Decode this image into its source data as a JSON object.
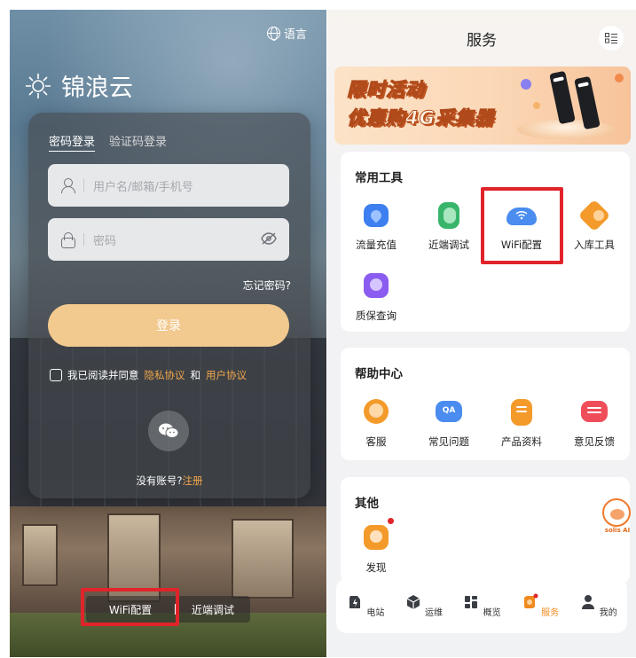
{
  "left": {
    "language_label": "语言",
    "brand_name": "锦浪云",
    "tabs": [
      "密码登录",
      "验证码登录"
    ],
    "username_placeholder": "用户名/邮箱/手机号",
    "password_placeholder": "密码",
    "forgot_label": "忘记密码?",
    "login_label": "登录",
    "agree": {
      "prefix": "我已阅读并同意",
      "privacy": "隐私协议",
      "and": "和",
      "user": "用户协议"
    },
    "no_account": {
      "prefix": "没有账号?",
      "register": "注册"
    },
    "bottom": {
      "wifi": "WiFi配置",
      "debug": "近端调试"
    }
  },
  "right": {
    "title": "服务",
    "banner": {
      "line1": "限时活动",
      "line2": "优惠购4G采集器"
    },
    "common_tools": {
      "title": "常用工具",
      "items": [
        {
          "label": "流量充值",
          "icon": "recharge-icon",
          "color": "#3d7ff0"
        },
        {
          "label": "近端调试",
          "icon": "debug-icon",
          "color": "#38b56a"
        },
        {
          "label": "WiFi配置",
          "icon": "wifi-config-icon",
          "color": "#4a8cf0"
        },
        {
          "label": "入库工具",
          "icon": "inbound-icon",
          "color": "#f39a2b"
        },
        {
          "label": "质保查询",
          "icon": "warranty-icon",
          "color": "#8a5cf0"
        }
      ]
    },
    "help_center": {
      "title": "帮助中心",
      "items": [
        {
          "label": "客服",
          "icon": "customer-service-icon",
          "color": "#f39a2b"
        },
        {
          "label": "常见问题",
          "icon": "faq-icon",
          "color": "#4a8cf0",
          "badge": "QA"
        },
        {
          "label": "产品资料",
          "icon": "product-docs-icon",
          "color": "#f39a2b"
        },
        {
          "label": "意见反馈",
          "icon": "feedback-icon",
          "color": "#ef4d5a"
        }
      ]
    },
    "other": {
      "title": "其他",
      "items": [
        {
          "label": "发现",
          "icon": "discover-icon",
          "color": "#f39a2b"
        }
      ]
    },
    "ai_label": "solis AI",
    "tabbar": [
      {
        "label": "电站",
        "icon": "station-icon"
      },
      {
        "label": "运维",
        "icon": "maintenance-icon"
      },
      {
        "label": "概览",
        "icon": "overview-icon"
      },
      {
        "label": "服务",
        "icon": "service-icon",
        "active": true
      },
      {
        "label": "我的",
        "icon": "profile-icon"
      }
    ],
    "colors": {
      "accent": "#f08a1e",
      "highlight": "#e0242a"
    }
  }
}
